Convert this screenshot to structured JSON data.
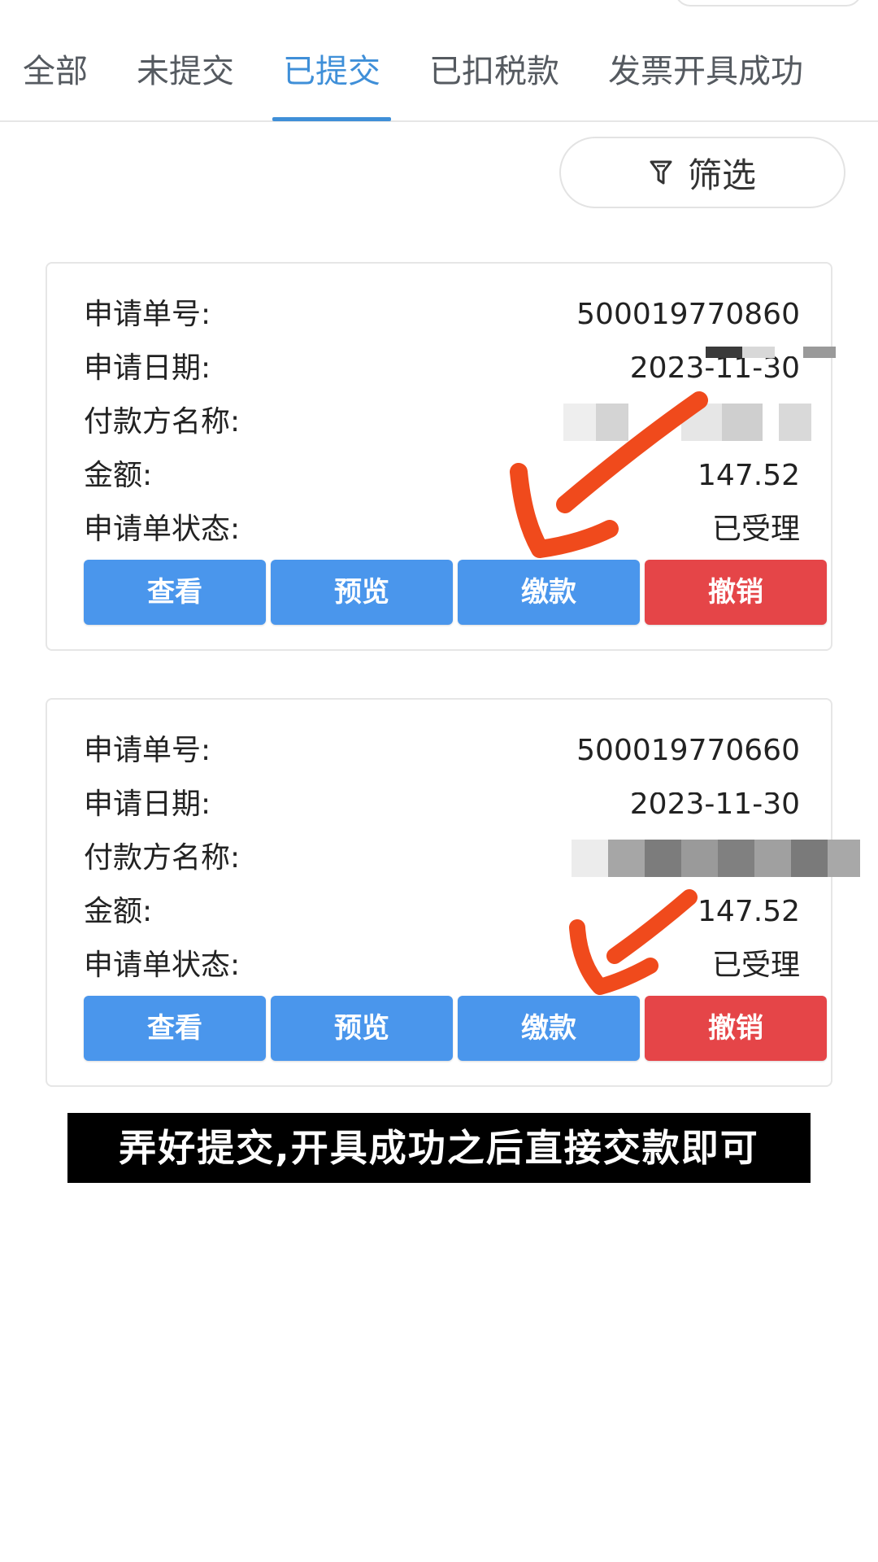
{
  "tabs": [
    {
      "label": "全部",
      "active": false
    },
    {
      "label": "未提交",
      "active": false
    },
    {
      "label": "已提交",
      "active": true
    },
    {
      "label": "已扣税款",
      "active": false
    },
    {
      "label": "发票开具成功",
      "active": false
    }
  ],
  "filter": {
    "label": "筛选",
    "icon": "filter-icon"
  },
  "cards": [
    {
      "fields": {
        "order_no_label": "申请单号:",
        "order_no": "500019770860",
        "date_label": "申请日期:",
        "date": "2023-11-30",
        "payer_label": "付款方名称:",
        "amount_label": "金额:",
        "amount": "147.52",
        "status_label": "申请单状态:",
        "status": "已受理"
      },
      "actions": {
        "view": "查看",
        "preview": "预览",
        "pay": "缴款",
        "revoke": "撤销"
      }
    },
    {
      "fields": {
        "order_no_label": "申请单号:",
        "order_no": "500019770660",
        "date_label": "申请日期:",
        "date": "2023-11-30",
        "payer_label": "付款方名称:",
        "amount_label": "金额:",
        "amount": "147.52",
        "status_label": "申请单状态:",
        "status": "已受理"
      },
      "actions": {
        "view": "查看",
        "preview": "预览",
        "pay": "缴款",
        "revoke": "撤销"
      }
    }
  ],
  "caption": "弄好提交,开具成功之后直接交款即可",
  "colors": {
    "accent": "#3f8fd8",
    "button_blue": "#4a96ec",
    "button_red": "#e54548",
    "annotation_arrow": "#f04a1c"
  }
}
